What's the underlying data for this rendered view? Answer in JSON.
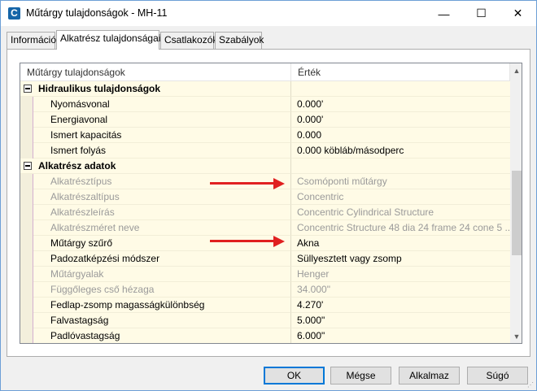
{
  "window": {
    "title": "Műtárgy tulajdonságok - MH-11",
    "app_icon": "C",
    "minimize": "—",
    "maximize": "☐",
    "close": "✕"
  },
  "tabs": [
    {
      "label": "Információ",
      "active": false
    },
    {
      "label": "Alkatrész tulajdonságai",
      "active": true
    },
    {
      "label": "Csatlakozók",
      "active": false
    },
    {
      "label": "Szabályok",
      "active": false
    }
  ],
  "grid": {
    "col_name": "Műtárgy tulajdonságok",
    "col_value": "Érték",
    "rows": [
      {
        "type": "group",
        "name": "Hidraulikus tulajdonságok",
        "value": ""
      },
      {
        "type": "item",
        "name": "Nyomásvonal",
        "value": "0.000'",
        "disabled": false
      },
      {
        "type": "item",
        "name": "Energiavonal",
        "value": "0.000'",
        "disabled": false
      },
      {
        "type": "item",
        "name": "Ismert kapacitás",
        "value": "0.000",
        "disabled": false
      },
      {
        "type": "item",
        "name": "Ismert folyás",
        "value": "0.000 köbláb/másodperc",
        "disabled": false
      },
      {
        "type": "group",
        "name": "Alkatrész adatok",
        "value": ""
      },
      {
        "type": "item",
        "name": "Alkatrésztípus",
        "value": "Csomóponti műtárgy",
        "disabled": true
      },
      {
        "type": "item",
        "name": "Alkatrészaltípus",
        "value": "Concentric",
        "disabled": true
      },
      {
        "type": "item",
        "name": "Alkatrészleírás",
        "value": "Concentric Cylindrical Structure",
        "disabled": true
      },
      {
        "type": "item",
        "name": "Alkatrészméret neve",
        "value": "Concentric Structure 48 dia 24 frame 24 cone 5 ...",
        "disabled": true
      },
      {
        "type": "item",
        "name": "Műtárgy szűrő",
        "value": "Akna",
        "disabled": false
      },
      {
        "type": "item",
        "name": "Padozatképzési módszer",
        "value": "Süllyesztett vagy zsomp",
        "disabled": false
      },
      {
        "type": "item",
        "name": "Műtárgyalak",
        "value": "Henger",
        "disabled": true
      },
      {
        "type": "item",
        "name": "Függőleges cső hézaga",
        "value": "34.000\"",
        "disabled": true
      },
      {
        "type": "item",
        "name": "Fedlap-zsomp magasságkülönbség",
        "value": "4.270'",
        "disabled": false
      },
      {
        "type": "item",
        "name": "Falvastagság",
        "value": "5.000\"",
        "disabled": false
      },
      {
        "type": "item",
        "name": "Padlóvastagság",
        "value": "6.000\"",
        "disabled": false
      }
    ]
  },
  "buttons": {
    "ok": "OK",
    "cancel": "Mégse",
    "apply": "Alkalmaz",
    "help": "Súgó"
  },
  "colors": {
    "row_background": "#fffbe6",
    "annotation_arrow": "#e02020",
    "disabled_text": "#9a9a9a"
  }
}
